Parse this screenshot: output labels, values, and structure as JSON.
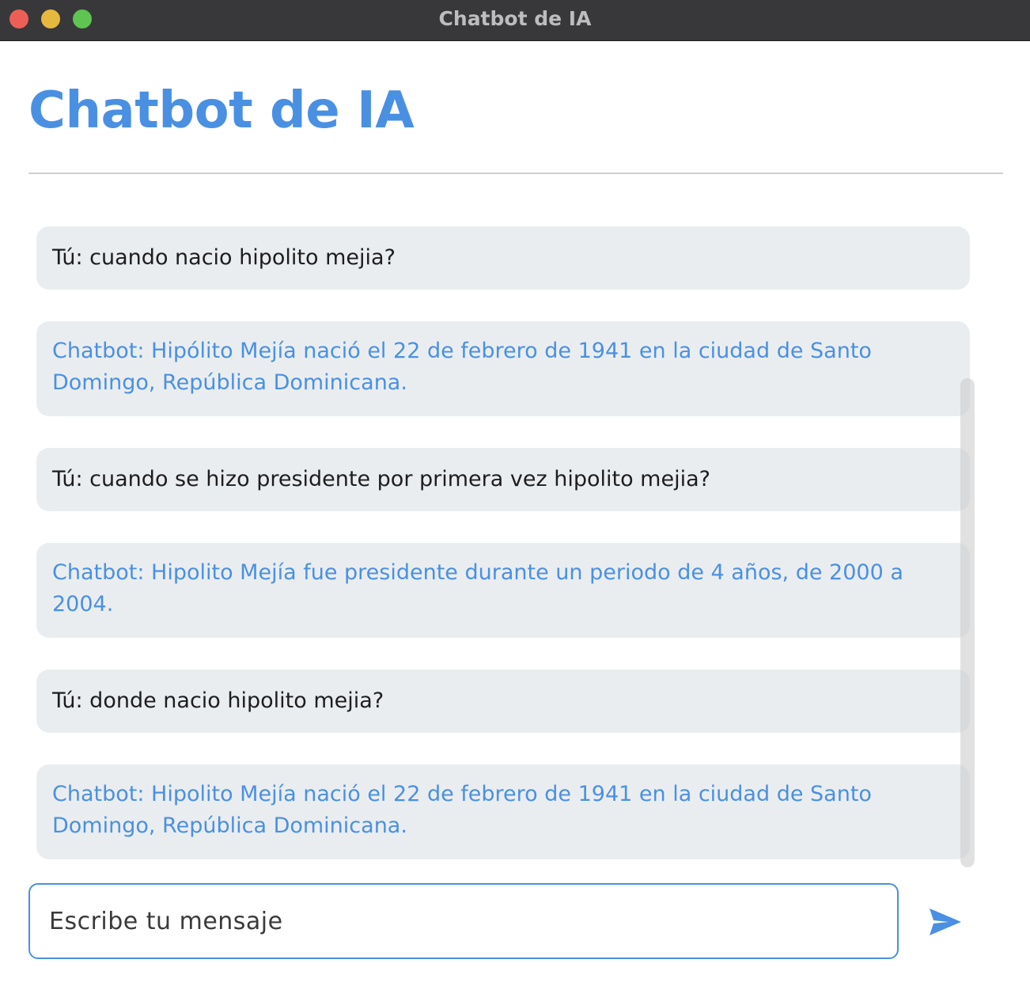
{
  "window": {
    "title": "Chatbot de IA"
  },
  "page": {
    "heading": "Chatbot de IA",
    "accent_color": "#4a90e2"
  },
  "messages": [
    {
      "role": "user",
      "text": "Tú: cuando nacio hipolito mejia?"
    },
    {
      "role": "bot",
      "text": "Chatbot: Hipólito Mejía nació el 22 de febrero de 1941 en la ciudad de Santo Domingo, República Dominicana."
    },
    {
      "role": "user",
      "text": "Tú: cuando se hizo presidente por primera vez hipolito mejia?"
    },
    {
      "role": "bot",
      "text": "Chatbot: Hipolito Mejía fue presidente durante un periodo de 4 años, de 2000 a 2004."
    },
    {
      "role": "user",
      "text": "Tú: donde nacio hipolito mejia?"
    },
    {
      "role": "bot",
      "text": "Chatbot: Hipolito Mejía nació el 22 de febrero de 1941 en la ciudad de Santo Domingo, República Dominicana."
    }
  ],
  "input": {
    "placeholder": "Escribe tu mensaje",
    "value": ""
  },
  "send_button": {
    "icon": "send-icon"
  }
}
